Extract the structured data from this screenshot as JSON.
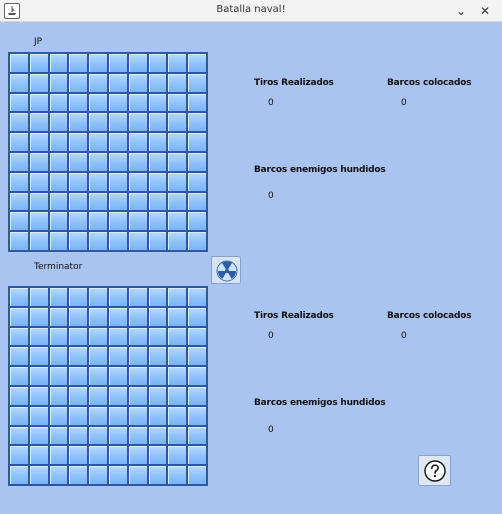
{
  "window": {
    "title": "Batalla naval!"
  },
  "player1": {
    "name": "JP",
    "shots_label": "Tiros Realizados",
    "shots_value": "0",
    "ships_label": "Barcos colocados",
    "ships_value": "0",
    "sunk_label": "Barcos enemigos hundidos",
    "sunk_value": "0"
  },
  "player2": {
    "name": "Terminator",
    "shots_label": "Tiros Realizados",
    "shots_value": "0",
    "ships_label": "Barcos colocados",
    "ships_value": "0",
    "sunk_label": "Barcos enemigos hundidos",
    "sunk_value": "0"
  },
  "board": {
    "rows": 10,
    "cols": 10
  },
  "icons": {
    "attack_button": "radiation-icon",
    "help_button": "question-icon"
  },
  "colors": {
    "background": "#a9c4f0",
    "cell": "#8ec2fb",
    "cell_border": "#2d56a4"
  }
}
